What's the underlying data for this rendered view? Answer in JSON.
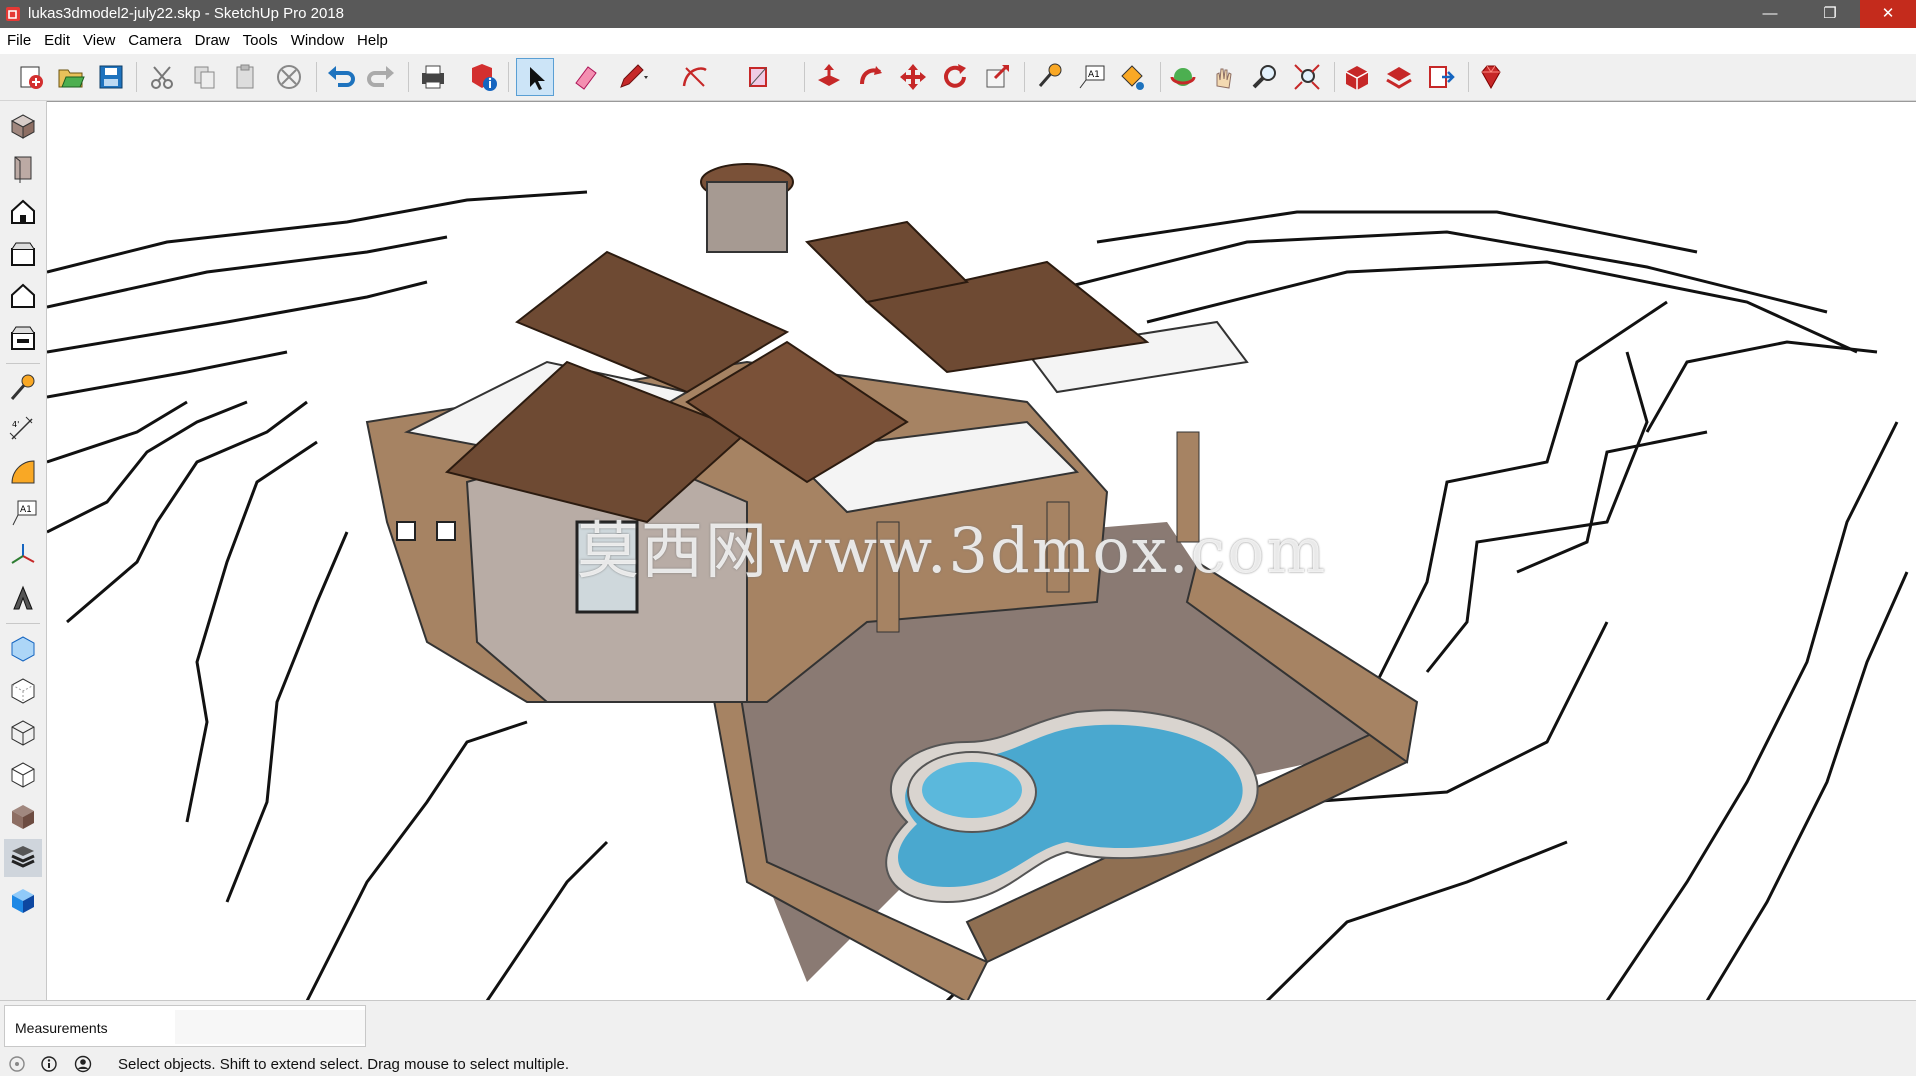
{
  "window": {
    "title": "lukas3dmodel2-july22.skp - SketchUp Pro 2018",
    "minimize_glyph": "—",
    "maximize_glyph": "❐",
    "close_glyph": "✕"
  },
  "menu": {
    "items": [
      "File",
      "Edit",
      "View",
      "Camera",
      "Draw",
      "Tools",
      "Window",
      "Help"
    ]
  },
  "toolbar": {
    "icons": [
      "new-file-icon",
      "open-folder-icon",
      "save-icon",
      "cut-icon",
      "copy-icon",
      "paste-icon",
      "erase-circle-icon",
      "undo-icon",
      "redo-icon",
      "print-icon",
      "model-info-icon",
      "select-arrow-icon",
      "eraser-icon",
      "pencil-line-icon",
      "arc-icon",
      "rectangle-icon",
      "push-pull-icon",
      "follow-me-icon",
      "move-icon",
      "rotate-icon",
      "scale-icon",
      "tape-measure-icon",
      "text-label-icon",
      "paint-bucket-icon",
      "orbit-icon",
      "pan-hand-icon",
      "zoom-icon",
      "zoom-extents-icon",
      "3d-warehouse-icon",
      "extension-warehouse-icon",
      "layout-send-icon",
      "ruby-icon"
    ],
    "active_tool": "select-arrow-icon"
  },
  "left_toolbar": {
    "icons": [
      "iso-view-icon",
      "top-view-icon",
      "front-view-icon",
      "right-view-icon",
      "back-view-icon",
      "left-view-icon",
      "tape-measure-icon",
      "dimension-icon",
      "protractor-icon",
      "text-icon",
      "axes-icon",
      "3d-text-icon",
      "xray-icon",
      "back-edges-icon",
      "wireframe-icon",
      "hidden-line-icon",
      "shaded-icon",
      "shaded-textures-icon",
      "monochrome-icon"
    ],
    "active_style": "shaded-textures-icon"
  },
  "viewport": {
    "watermark": "莫西网www.3dmox.com"
  },
  "measurements": {
    "label": "Measurements",
    "value": ""
  },
  "status": {
    "icons": [
      "geo-location-icon",
      "info-credits-icon",
      "user-account-icon"
    ],
    "message": "Select objects. Shift to extend select. Drag mouse to select multiple."
  },
  "colors": {
    "titlebar": "#595959",
    "close_button": "#c42b1c",
    "roof": "#6e4a33",
    "wall": "#a68363",
    "pool_water": "#4aa8cf",
    "terrain": "#ffffff"
  }
}
